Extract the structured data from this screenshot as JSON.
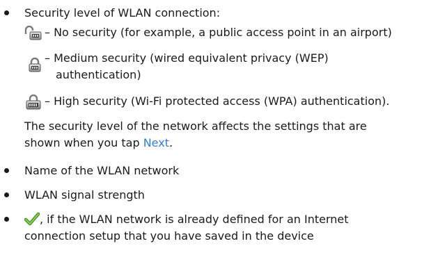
{
  "bullets": {
    "security": {
      "label": "Security level of WLAN connection:",
      "items": [
        {
          "icon": "open-padlock-icon",
          "line1": "– No security (for example, a public access point in an airport)"
        },
        {
          "icon": "padlock-icon",
          "line1": "– Medium security (wired equivalent privacy (WEP)",
          "line2": "authentication)"
        },
        {
          "icon": "locked-padlock-icon",
          "line1": "– High security (Wi-Fi protected access (WPA) authentication)."
        }
      ],
      "note_line1": "The security level of the network affects the settings that are",
      "note_line2_prefix": "shown when you tap ",
      "note_link": "Next",
      "note_line2_suffix": "."
    },
    "name": "Name of the WLAN network",
    "signal": "WLAN signal strength",
    "defined": {
      "icon": "checkmark-icon",
      "line1": ", if the WLAN network is already defined for an Internet",
      "line2": "connection setup that you have saved in the device"
    }
  },
  "colors": {
    "text": "#1a1a1a",
    "link": "#2d7fd6",
    "check": "#5aa832"
  }
}
